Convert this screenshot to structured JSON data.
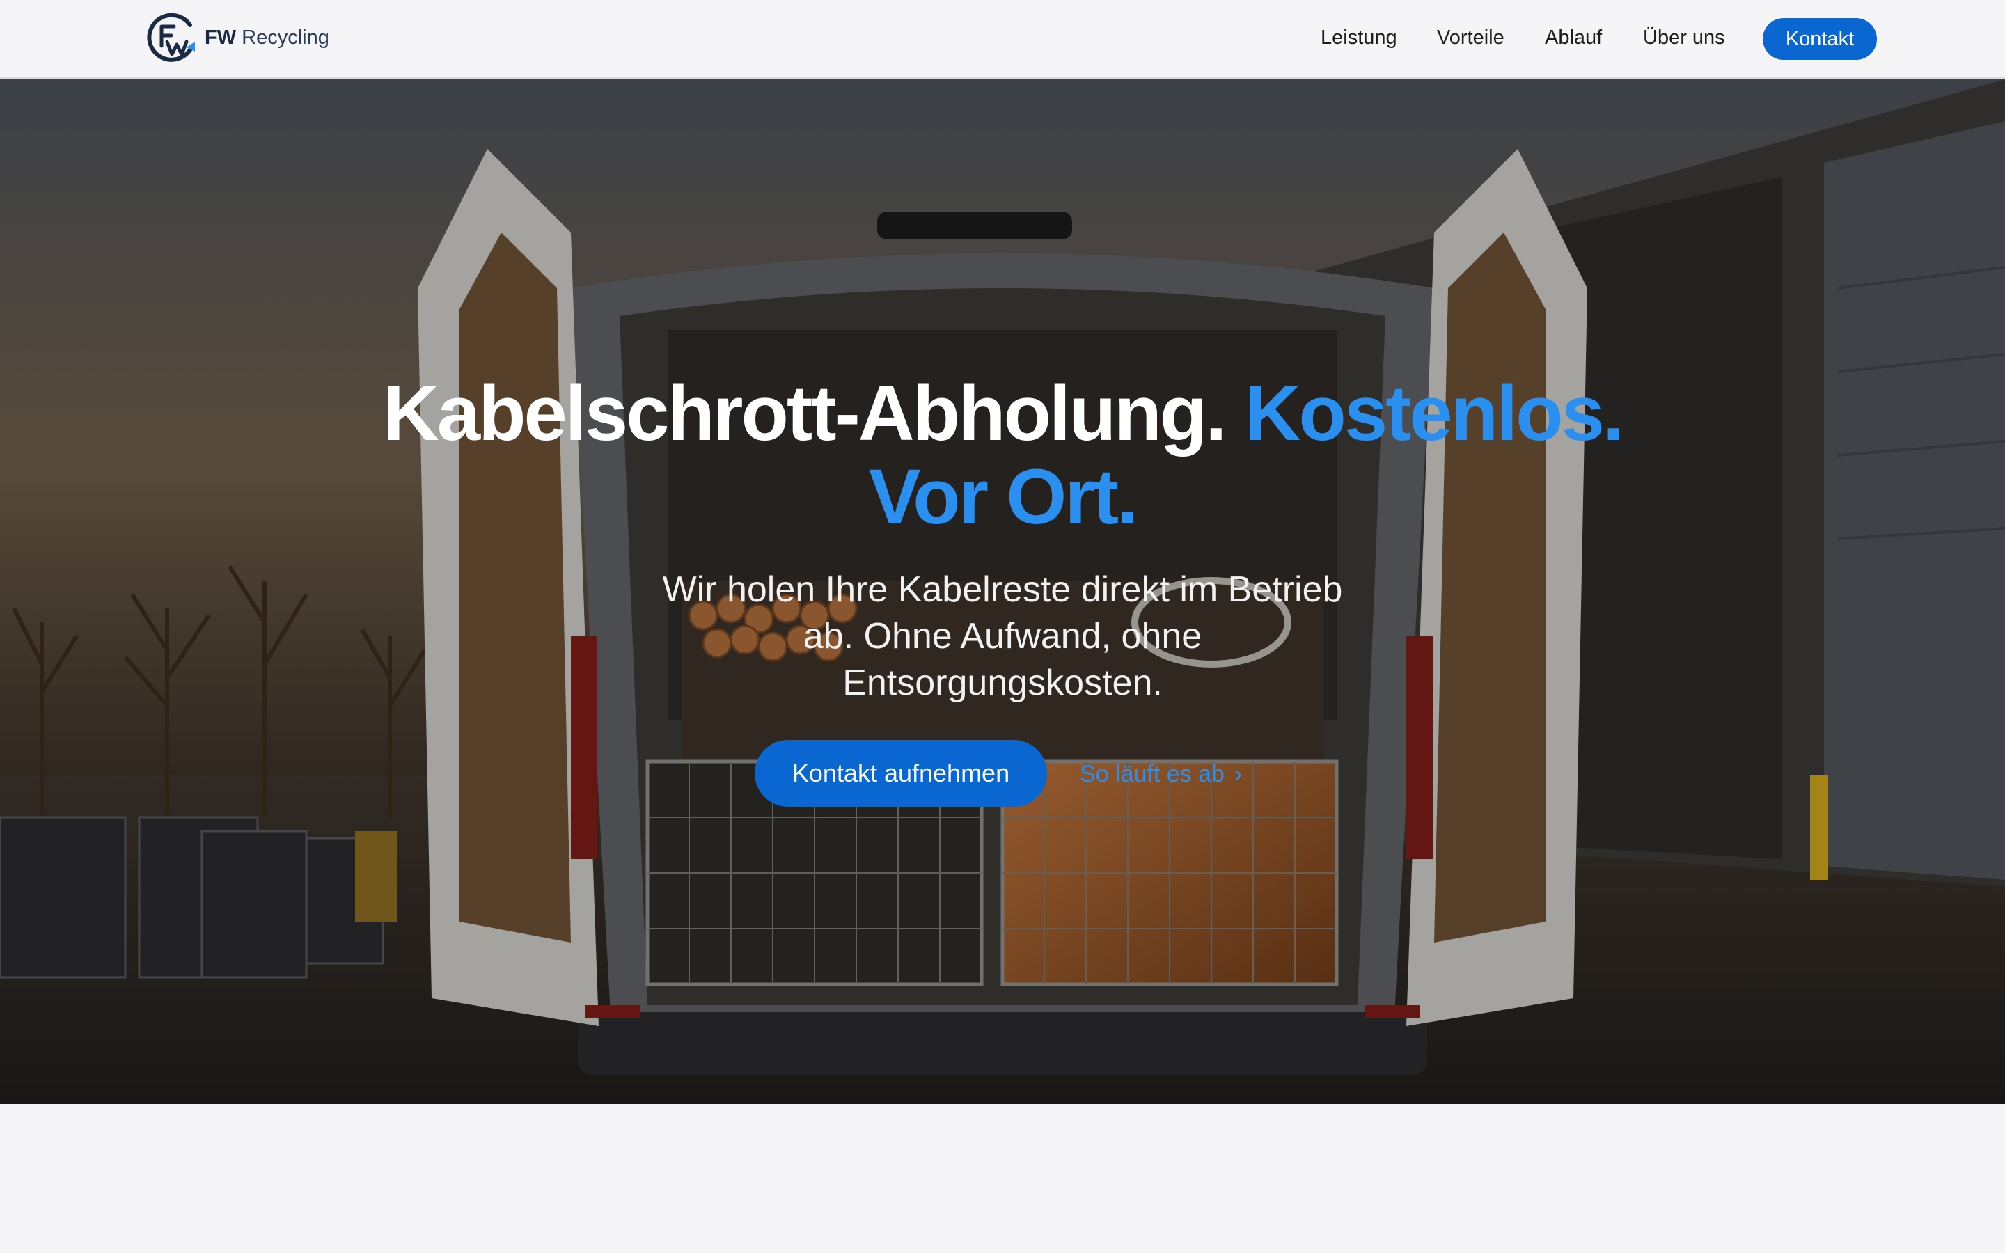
{
  "header": {
    "brand_bold": "FW",
    "brand_rest": "Recycling",
    "nav": [
      "Leistung",
      "Vorteile",
      "Ablauf",
      "Über uns"
    ],
    "cta": "Kontakt"
  },
  "hero": {
    "headline_white": "Kabelschrott-Abholung.",
    "headline_blue_1": "Kostenlos.",
    "headline_blue_2": "Vor Ort.",
    "subline": "Wir holen Ihre Kabelreste direkt im Betrieb ab. Ohne Aufwand, ohne Entsorgungskosten.",
    "primary_cta": "Kontakt aufnehmen",
    "secondary_link": "So läuft es ab",
    "secondary_link_icon": "chevron-right-icon"
  },
  "colors": {
    "accent": "#0a66d1",
    "accent_light": "#2b8ff0",
    "page_bg": "#f5f5f7",
    "brand_navy": "#1c2b45"
  }
}
